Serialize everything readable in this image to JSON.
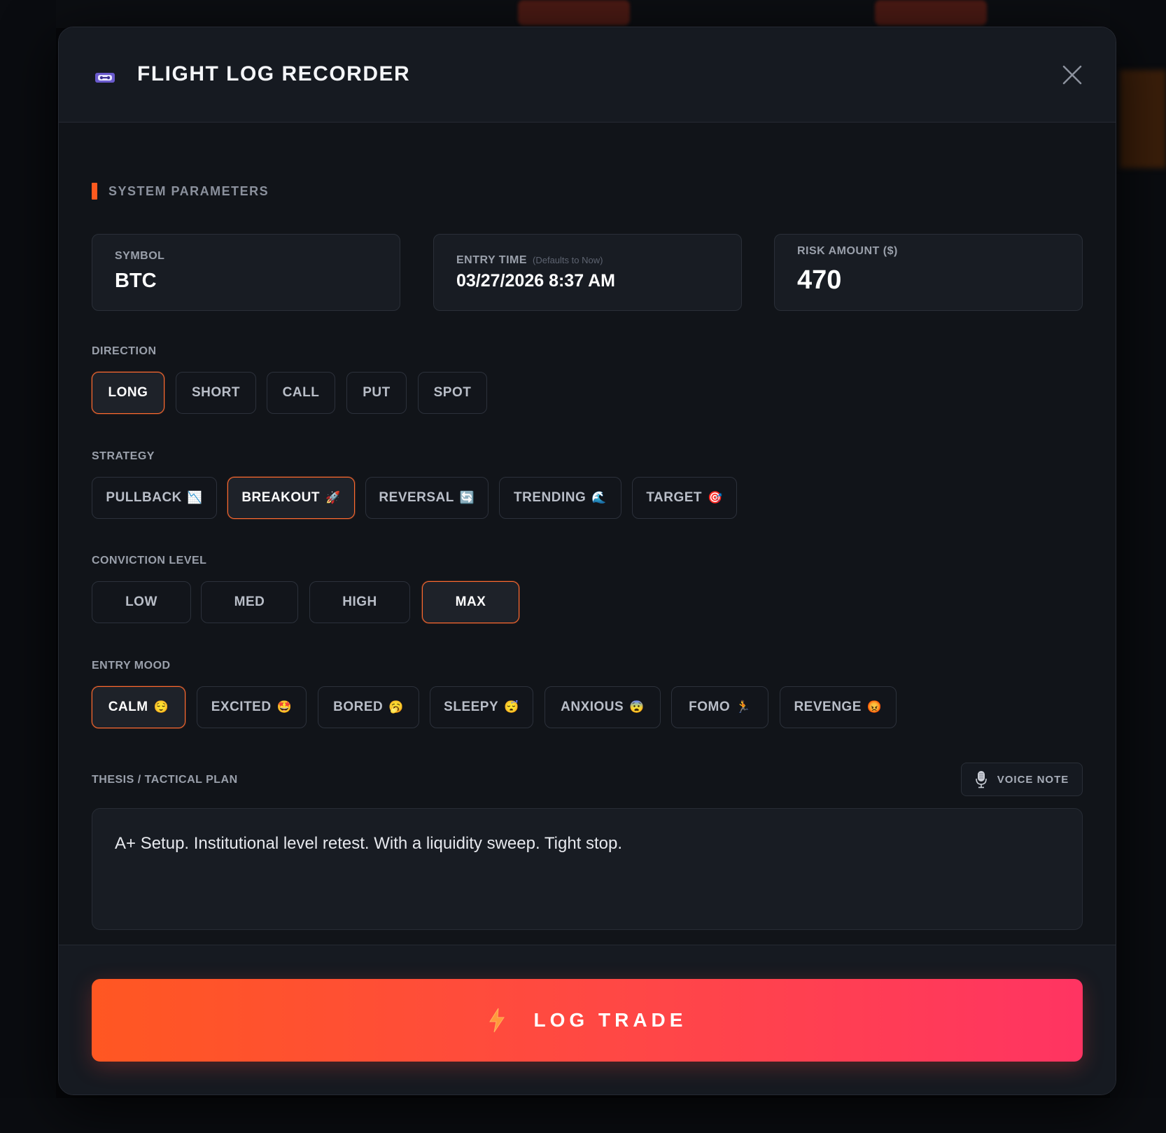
{
  "modal": {
    "title": "FLIGHT LOG RECORDER",
    "icon": "cassette-tape-icon",
    "close_icon": "close-icon"
  },
  "section": {
    "title": "SYSTEM PARAMETERS",
    "accent": "#ff5a1f"
  },
  "params": {
    "symbol": {
      "label": "SYMBOL",
      "value": "BTC"
    },
    "entry_time": {
      "label": "ENTRY TIME",
      "hint": "(Defaults to Now)",
      "value": "03/27/2026 8:37 AM"
    },
    "risk": {
      "label": "RISK AMOUNT ($)",
      "value": "470"
    }
  },
  "direction": {
    "label": "DIRECTION",
    "selected": "LONG",
    "options": [
      {
        "label": "LONG",
        "active": true
      },
      {
        "label": "SHORT"
      },
      {
        "label": "CALL"
      },
      {
        "label": "PUT"
      },
      {
        "label": "SPOT"
      }
    ]
  },
  "strategy": {
    "label": "STRATEGY",
    "selected": "BREAKOUT",
    "options": [
      {
        "label": "PULLBACK",
        "emoji": "📉"
      },
      {
        "label": "BREAKOUT",
        "emoji": "🚀",
        "active": true
      },
      {
        "label": "REVERSAL",
        "emoji": "🔄"
      },
      {
        "label": "TRENDING",
        "emoji": "🌊"
      },
      {
        "label": "TARGET",
        "emoji": "🎯"
      }
    ]
  },
  "conviction": {
    "label": "CONVICTION LEVEL",
    "selected": "MAX",
    "options": [
      {
        "label": "LOW"
      },
      {
        "label": "MED"
      },
      {
        "label": "HIGH"
      },
      {
        "label": "MAX",
        "active": true
      }
    ]
  },
  "mood": {
    "label": "ENTRY MOOD",
    "selected": "CALM",
    "options": [
      {
        "label": "CALM",
        "emoji": "😌",
        "active": true
      },
      {
        "label": "EXCITED",
        "emoji": "🤩"
      },
      {
        "label": "BORED",
        "emoji": "🥱"
      },
      {
        "label": "SLEEPY",
        "emoji": "😴"
      },
      {
        "label": "ANXIOUS",
        "emoji": "😨"
      },
      {
        "label": "FOMO",
        "emoji": "🏃"
      },
      {
        "label": "REVENGE",
        "emoji": "😡"
      }
    ]
  },
  "thesis": {
    "label": "THESIS / TACTICAL PLAN",
    "value": "A+ Setup. Institutional level retest. With a liquidity sweep. Tight stop.",
    "voice_label": "VOICE NOTE",
    "voice_icon": "microphone-icon"
  },
  "submit": {
    "label": "LOG TRADE",
    "icon": "lightning-icon",
    "gradient": [
      "#ff5722",
      "#ff3462"
    ]
  }
}
